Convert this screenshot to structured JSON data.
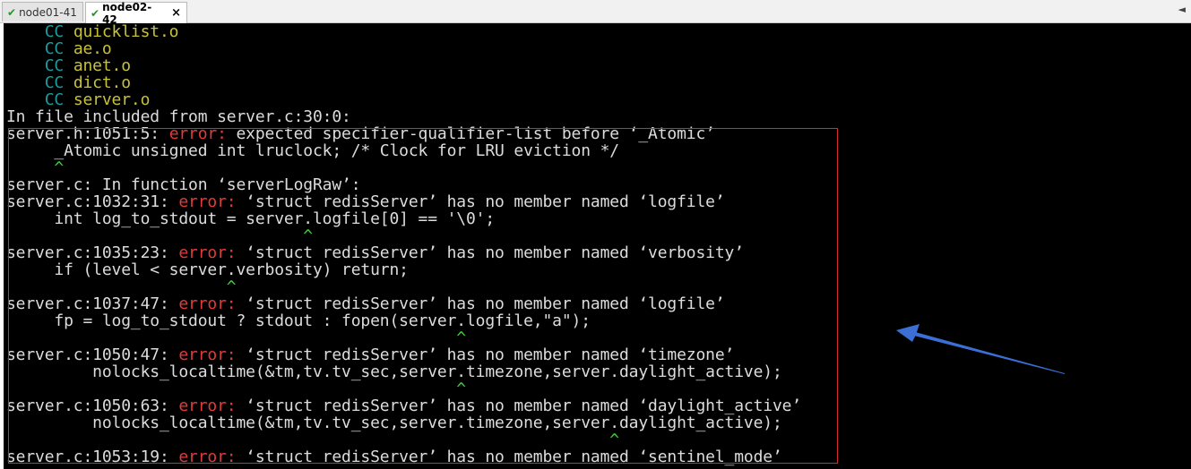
{
  "tabs": [
    {
      "label": "node01-41",
      "active": false
    },
    {
      "label": "node02-42",
      "active": true
    }
  ],
  "tab_close": "×",
  "tab_menu": "◄",
  "colors": {
    "cc": "#1a9c9c",
    "object": "#c7c13a",
    "error": "#e23a3a",
    "caret": "#3ad63a",
    "box": "#d82a2a",
    "arrow": "#3b6fd6"
  },
  "terminal": {
    "build_lines": [
      {
        "tag": "CC",
        "file": "quicklist.o"
      },
      {
        "tag": "CC",
        "file": "ae.o"
      },
      {
        "tag": "CC",
        "file": "anet.o"
      },
      {
        "tag": "CC",
        "file": "dict.o"
      },
      {
        "tag": "CC",
        "file": "server.o"
      }
    ],
    "included_from": "In file included from server.c:30:0:",
    "messages": [
      {
        "location": "server.h:1051:5: ",
        "level": "error:",
        "message": " expected specifier-qualifier-list before ‘_Atomic’",
        "code": "     _Atomic unsigned int lruclock; /* Clock for LRU eviction */",
        "caret": "     ^"
      },
      {
        "location": "server.c: In function ‘serverLogRaw’:"
      },
      {
        "location": "server.c:1032:31: ",
        "level": "error:",
        "message": " ‘struct redisServer’ has no member named ‘logfile’",
        "code": "     int log_to_stdout = server.logfile[0] == '\\0';",
        "caret": "                               ^"
      },
      {
        "location": "server.c:1035:23: ",
        "level": "error:",
        "message": " ‘struct redisServer’ has no member named ‘verbosity’",
        "code": "     if (level < server.verbosity) return;",
        "caret": "                       ^"
      },
      {
        "location": "server.c:1037:47: ",
        "level": "error:",
        "message": " ‘struct redisServer’ has no member named ‘logfile’",
        "code": "     fp = log_to_stdout ? stdout : fopen(server.logfile,\"a\");",
        "caret": "                                               ^"
      },
      {
        "location": "server.c:1050:47: ",
        "level": "error:",
        "message": " ‘struct redisServer’ has no member named ‘timezone’",
        "code": "         nolocks_localtime(&tm,tv.tv_sec,server.timezone,server.daylight_active);",
        "caret": "                                               ^"
      },
      {
        "location": "server.c:1050:63: ",
        "level": "error:",
        "message": " ‘struct redisServer’ has no member named ‘daylight_active’",
        "code": "         nolocks_localtime(&tm,tv.tv_sec,server.timezone,server.daylight_active);",
        "caret": "                                                               ^"
      },
      {
        "location": "server.c:1053:19: ",
        "level": "error:",
        "message": " ‘struct redisServer’ has no member named ‘sentinel_mode’"
      }
    ]
  }
}
